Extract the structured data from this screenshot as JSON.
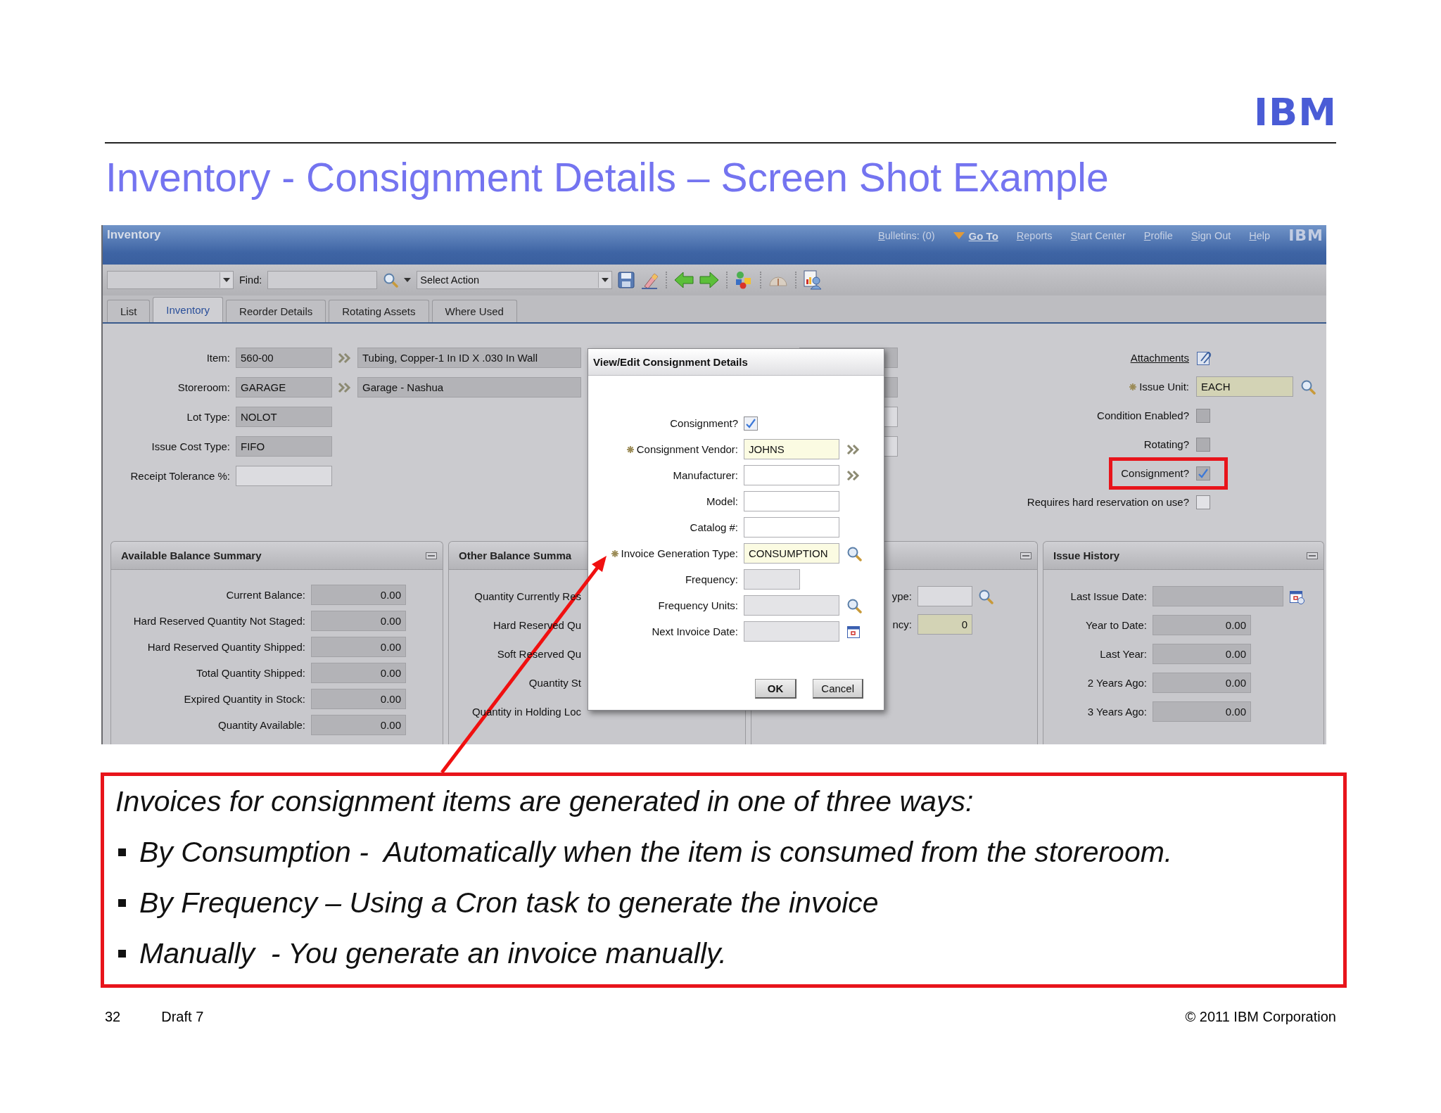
{
  "slide": {
    "logo": "IBM",
    "title": "Inventory - Consignment Details – Screen Shot Example"
  },
  "app": {
    "header": {
      "title": "Inventory",
      "logo": "IBM",
      "links": [
        {
          "label": "Bulletins: (0)",
          "kind": "link"
        },
        {
          "label": "Go To",
          "kind": "menu"
        },
        {
          "label": "Reports",
          "kind": "link"
        },
        {
          "label": "Start Center",
          "kind": "link"
        },
        {
          "label": "Profile",
          "kind": "link"
        },
        {
          "label": "Sign Out",
          "kind": "link"
        },
        {
          "label": "Help",
          "kind": "link"
        }
      ]
    },
    "toolbar": {
      "find_label": "Find:",
      "action": "Select Action"
    },
    "tabs": [
      {
        "label": "List",
        "selected": false
      },
      {
        "label": "Inventory",
        "selected": true
      },
      {
        "label": "Reorder Details",
        "selected": false
      },
      {
        "label": "Rotating Assets",
        "selected": false
      },
      {
        "label": "Where Used",
        "selected": false
      }
    ],
    "form_left": [
      {
        "label": "Item:",
        "value": "560-00",
        "readonly": true,
        "description": "Tubing, Copper-1 In ID X .030 In Wall"
      },
      {
        "label": "Storeroom:",
        "value": "GARAGE",
        "readonly": true,
        "description": "Garage - Nashua"
      },
      {
        "label": "Lot Type:",
        "value": "NOLOT",
        "readonly": true
      },
      {
        "label": "Issue Cost Type:",
        "value": "FIFO",
        "readonly": true
      },
      {
        "label": "Receipt Tolerance %:",
        "readonly": false
      }
    ],
    "form_middle": [
      {
        "readonly": true
      },
      {
        "readonly": true
      },
      {
        "readonly": false
      },
      {
        "readonly": false
      }
    ],
    "form_right": {
      "attachments": "Attachments",
      "fields": [
        {
          "kind": "lookup",
          "label": "Issue Unit:",
          "value": "EACH",
          "required": true
        },
        {
          "kind": "checkbox",
          "label": "Condition Enabled?",
          "checked": false,
          "readonly": true,
          "highlighted": false
        },
        {
          "kind": "checkbox",
          "label": "Rotating?",
          "checked": false,
          "readonly": true,
          "highlighted": false
        },
        {
          "kind": "checkbox",
          "label": "Consignment?",
          "checked": true,
          "readonly": true,
          "highlighted": true
        },
        {
          "kind": "checkbox",
          "label": "Requires hard reservation on use?",
          "checked": false,
          "readonly": false,
          "highlighted": false
        }
      ]
    },
    "panels": [
      {
        "title": "Available Balance Summary",
        "rows": [
          {
            "kind": "text",
            "label": "Current Balance:",
            "value": "0.00",
            "readonly": true
          },
          {
            "kind": "text",
            "label": "Hard Reserved Quantity Not Staged:",
            "value": "0.00",
            "readonly": true
          },
          {
            "kind": "text",
            "label": "Hard Reserved Quantity Shipped:",
            "value": "0.00",
            "readonly": true
          },
          {
            "kind": "text",
            "label": "Total Quantity Shipped:",
            "value": "0.00",
            "readonly": true
          },
          {
            "kind": "text",
            "label": "Expired Quantity in Stock:",
            "value": "0.00",
            "readonly": true
          },
          {
            "kind": "text",
            "label": "Quantity Available:",
            "value": "0.00",
            "readonly": true
          }
        ]
      },
      {
        "title": "Other Balance Summa",
        "rows": [
          {
            "kind": "label",
            "label": "Quantity Currently Res"
          },
          {
            "kind": "label",
            "label": "Hard Reserved Qu"
          },
          {
            "kind": "label",
            "label": "Soft Reserved Qu"
          },
          {
            "kind": "label",
            "label": "Quantity St"
          },
          {
            "kind": "label",
            "label": "Quantity in Holding Loc"
          }
        ]
      },
      {
        "rows": [
          {
            "kind": "lookup",
            "label": "ype:",
            "readonly": false,
            "required": false
          },
          {
            "kind": "text",
            "label": "ncy:",
            "value": "0",
            "readonly": false,
            "required": true
          }
        ]
      },
      {
        "title": "Issue History",
        "rows": [
          {
            "kind": "date",
            "label": "Last Issue Date:",
            "readonly": true
          },
          {
            "kind": "text",
            "label": "Year to Date:",
            "value": "0.00",
            "readonly": true
          },
          {
            "kind": "text",
            "label": "Last Year:",
            "value": "0.00",
            "readonly": true
          },
          {
            "kind": "text",
            "label": "2 Years Ago:",
            "value": "0.00",
            "readonly": true
          },
          {
            "kind": "text",
            "label": "3 Years Ago:",
            "value": "0.00",
            "readonly": true
          }
        ]
      }
    ],
    "dialog": {
      "title": "View/Edit Consignment Details",
      "fields": [
        {
          "kind": "checkbox",
          "label": "Consignment?",
          "checked": true
        },
        {
          "kind": "text",
          "label": "Consignment Vendor:",
          "value": "JOHNS",
          "required": true,
          "readonly": false,
          "short": false,
          "detail": true,
          "lookup": false,
          "calendar": false
        },
        {
          "kind": "text",
          "label": "Manufacturer:",
          "required": false,
          "readonly": false,
          "short": false,
          "detail": true,
          "lookup": false,
          "calendar": false
        },
        {
          "kind": "text",
          "label": "Model:",
          "required": false,
          "readonly": false,
          "short": false,
          "detail": false,
          "lookup": false,
          "calendar": false
        },
        {
          "kind": "text",
          "label": "Catalog #:",
          "required": false,
          "readonly": false,
          "short": false,
          "detail": false,
          "lookup": false,
          "calendar": false
        },
        {
          "kind": "text",
          "label": "Invoice Generation Type:",
          "value": "CONSUMPTION",
          "required": true,
          "readonly": false,
          "short": false,
          "detail": false,
          "lookup": true,
          "calendar": false
        },
        {
          "kind": "text",
          "label": "Frequency:",
          "required": false,
          "readonly": true,
          "short": true,
          "detail": false,
          "lookup": false,
          "calendar": false
        },
        {
          "kind": "text",
          "label": "Frequency Units:",
          "required": false,
          "readonly": true,
          "short": false,
          "detail": false,
          "lookup": true,
          "calendar": false
        },
        {
          "kind": "text",
          "label": "Next Invoice Date:",
          "required": false,
          "readonly": true,
          "short": false,
          "detail": false,
          "lookup": false,
          "calendar": true
        }
      ],
      "buttons": [
        {
          "label": "OK",
          "default": true
        },
        {
          "label": "Cancel",
          "default": false
        }
      ]
    }
  },
  "callout": {
    "heading": "Invoices for consignment items are generated in one of three ways:",
    "bullets": [
      "By Consumption -  Automatically when the item is consumed from the storeroom.",
      "By Frequency – Using a Cron task to generate the invoice",
      "Manually  - You generate an invoice manually."
    ]
  },
  "footer": {
    "page": "32",
    "draft": "Draft 7",
    "copyright": "© 2011 IBM Corporation"
  }
}
